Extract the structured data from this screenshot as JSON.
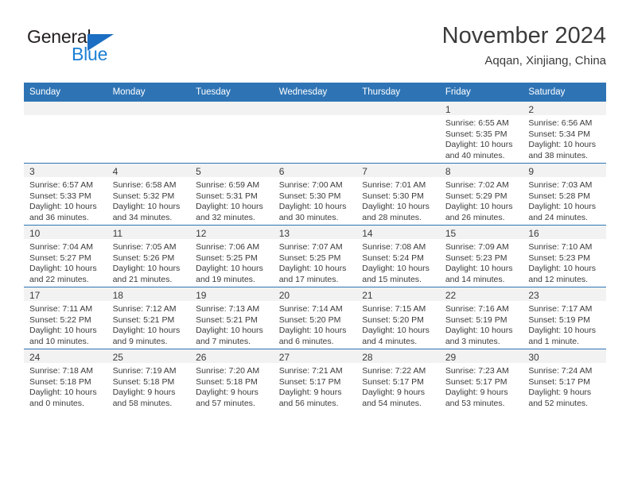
{
  "brand": {
    "name_top": "General",
    "name_bottom": "Blue",
    "triangle_color": "#1b6ec2",
    "text_color": "#231f20",
    "blue_color": "#1b7fd4"
  },
  "header": {
    "title": "November 2024",
    "subtitle": "Aqqan, Xinjiang, China",
    "header_bg": "#2e74b5",
    "daynum_bg": "#f2f2f2"
  },
  "weekdays": [
    "Sunday",
    "Monday",
    "Tuesday",
    "Wednesday",
    "Thursday",
    "Friday",
    "Saturday"
  ],
  "weeks": [
    [
      {
        "day": "",
        "lines": []
      },
      {
        "day": "",
        "lines": []
      },
      {
        "day": "",
        "lines": []
      },
      {
        "day": "",
        "lines": []
      },
      {
        "day": "",
        "lines": []
      },
      {
        "day": "1",
        "lines": [
          "Sunrise: 6:55 AM",
          "Sunset: 5:35 PM",
          "Daylight: 10 hours",
          "and 40 minutes."
        ]
      },
      {
        "day": "2",
        "lines": [
          "Sunrise: 6:56 AM",
          "Sunset: 5:34 PM",
          "Daylight: 10 hours",
          "and 38 minutes."
        ]
      }
    ],
    [
      {
        "day": "3",
        "lines": [
          "Sunrise: 6:57 AM",
          "Sunset: 5:33 PM",
          "Daylight: 10 hours",
          "and 36 minutes."
        ]
      },
      {
        "day": "4",
        "lines": [
          "Sunrise: 6:58 AM",
          "Sunset: 5:32 PM",
          "Daylight: 10 hours",
          "and 34 minutes."
        ]
      },
      {
        "day": "5",
        "lines": [
          "Sunrise: 6:59 AM",
          "Sunset: 5:31 PM",
          "Daylight: 10 hours",
          "and 32 minutes."
        ]
      },
      {
        "day": "6",
        "lines": [
          "Sunrise: 7:00 AM",
          "Sunset: 5:30 PM",
          "Daylight: 10 hours",
          "and 30 minutes."
        ]
      },
      {
        "day": "7",
        "lines": [
          "Sunrise: 7:01 AM",
          "Sunset: 5:30 PM",
          "Daylight: 10 hours",
          "and 28 minutes."
        ]
      },
      {
        "day": "8",
        "lines": [
          "Sunrise: 7:02 AM",
          "Sunset: 5:29 PM",
          "Daylight: 10 hours",
          "and 26 minutes."
        ]
      },
      {
        "day": "9",
        "lines": [
          "Sunrise: 7:03 AM",
          "Sunset: 5:28 PM",
          "Daylight: 10 hours",
          "and 24 minutes."
        ]
      }
    ],
    [
      {
        "day": "10",
        "lines": [
          "Sunrise: 7:04 AM",
          "Sunset: 5:27 PM",
          "Daylight: 10 hours",
          "and 22 minutes."
        ]
      },
      {
        "day": "11",
        "lines": [
          "Sunrise: 7:05 AM",
          "Sunset: 5:26 PM",
          "Daylight: 10 hours",
          "and 21 minutes."
        ]
      },
      {
        "day": "12",
        "lines": [
          "Sunrise: 7:06 AM",
          "Sunset: 5:25 PM",
          "Daylight: 10 hours",
          "and 19 minutes."
        ]
      },
      {
        "day": "13",
        "lines": [
          "Sunrise: 7:07 AM",
          "Sunset: 5:25 PM",
          "Daylight: 10 hours",
          "and 17 minutes."
        ]
      },
      {
        "day": "14",
        "lines": [
          "Sunrise: 7:08 AM",
          "Sunset: 5:24 PM",
          "Daylight: 10 hours",
          "and 15 minutes."
        ]
      },
      {
        "day": "15",
        "lines": [
          "Sunrise: 7:09 AM",
          "Sunset: 5:23 PM",
          "Daylight: 10 hours",
          "and 14 minutes."
        ]
      },
      {
        "day": "16",
        "lines": [
          "Sunrise: 7:10 AM",
          "Sunset: 5:23 PM",
          "Daylight: 10 hours",
          "and 12 minutes."
        ]
      }
    ],
    [
      {
        "day": "17",
        "lines": [
          "Sunrise: 7:11 AM",
          "Sunset: 5:22 PM",
          "Daylight: 10 hours",
          "and 10 minutes."
        ]
      },
      {
        "day": "18",
        "lines": [
          "Sunrise: 7:12 AM",
          "Sunset: 5:21 PM",
          "Daylight: 10 hours",
          "and 9 minutes."
        ]
      },
      {
        "day": "19",
        "lines": [
          "Sunrise: 7:13 AM",
          "Sunset: 5:21 PM",
          "Daylight: 10 hours",
          "and 7 minutes."
        ]
      },
      {
        "day": "20",
        "lines": [
          "Sunrise: 7:14 AM",
          "Sunset: 5:20 PM",
          "Daylight: 10 hours",
          "and 6 minutes."
        ]
      },
      {
        "day": "21",
        "lines": [
          "Sunrise: 7:15 AM",
          "Sunset: 5:20 PM",
          "Daylight: 10 hours",
          "and 4 minutes."
        ]
      },
      {
        "day": "22",
        "lines": [
          "Sunrise: 7:16 AM",
          "Sunset: 5:19 PM",
          "Daylight: 10 hours",
          "and 3 minutes."
        ]
      },
      {
        "day": "23",
        "lines": [
          "Sunrise: 7:17 AM",
          "Sunset: 5:19 PM",
          "Daylight: 10 hours",
          "and 1 minute."
        ]
      }
    ],
    [
      {
        "day": "24",
        "lines": [
          "Sunrise: 7:18 AM",
          "Sunset: 5:18 PM",
          "Daylight: 10 hours",
          "and 0 minutes."
        ]
      },
      {
        "day": "25",
        "lines": [
          "Sunrise: 7:19 AM",
          "Sunset: 5:18 PM",
          "Daylight: 9 hours",
          "and 58 minutes."
        ]
      },
      {
        "day": "26",
        "lines": [
          "Sunrise: 7:20 AM",
          "Sunset: 5:18 PM",
          "Daylight: 9 hours",
          "and 57 minutes."
        ]
      },
      {
        "day": "27",
        "lines": [
          "Sunrise: 7:21 AM",
          "Sunset: 5:17 PM",
          "Daylight: 9 hours",
          "and 56 minutes."
        ]
      },
      {
        "day": "28",
        "lines": [
          "Sunrise: 7:22 AM",
          "Sunset: 5:17 PM",
          "Daylight: 9 hours",
          "and 54 minutes."
        ]
      },
      {
        "day": "29",
        "lines": [
          "Sunrise: 7:23 AM",
          "Sunset: 5:17 PM",
          "Daylight: 9 hours",
          "and 53 minutes."
        ]
      },
      {
        "day": "30",
        "lines": [
          "Sunrise: 7:24 AM",
          "Sunset: 5:17 PM",
          "Daylight: 9 hours",
          "and 52 minutes."
        ]
      }
    ]
  ]
}
